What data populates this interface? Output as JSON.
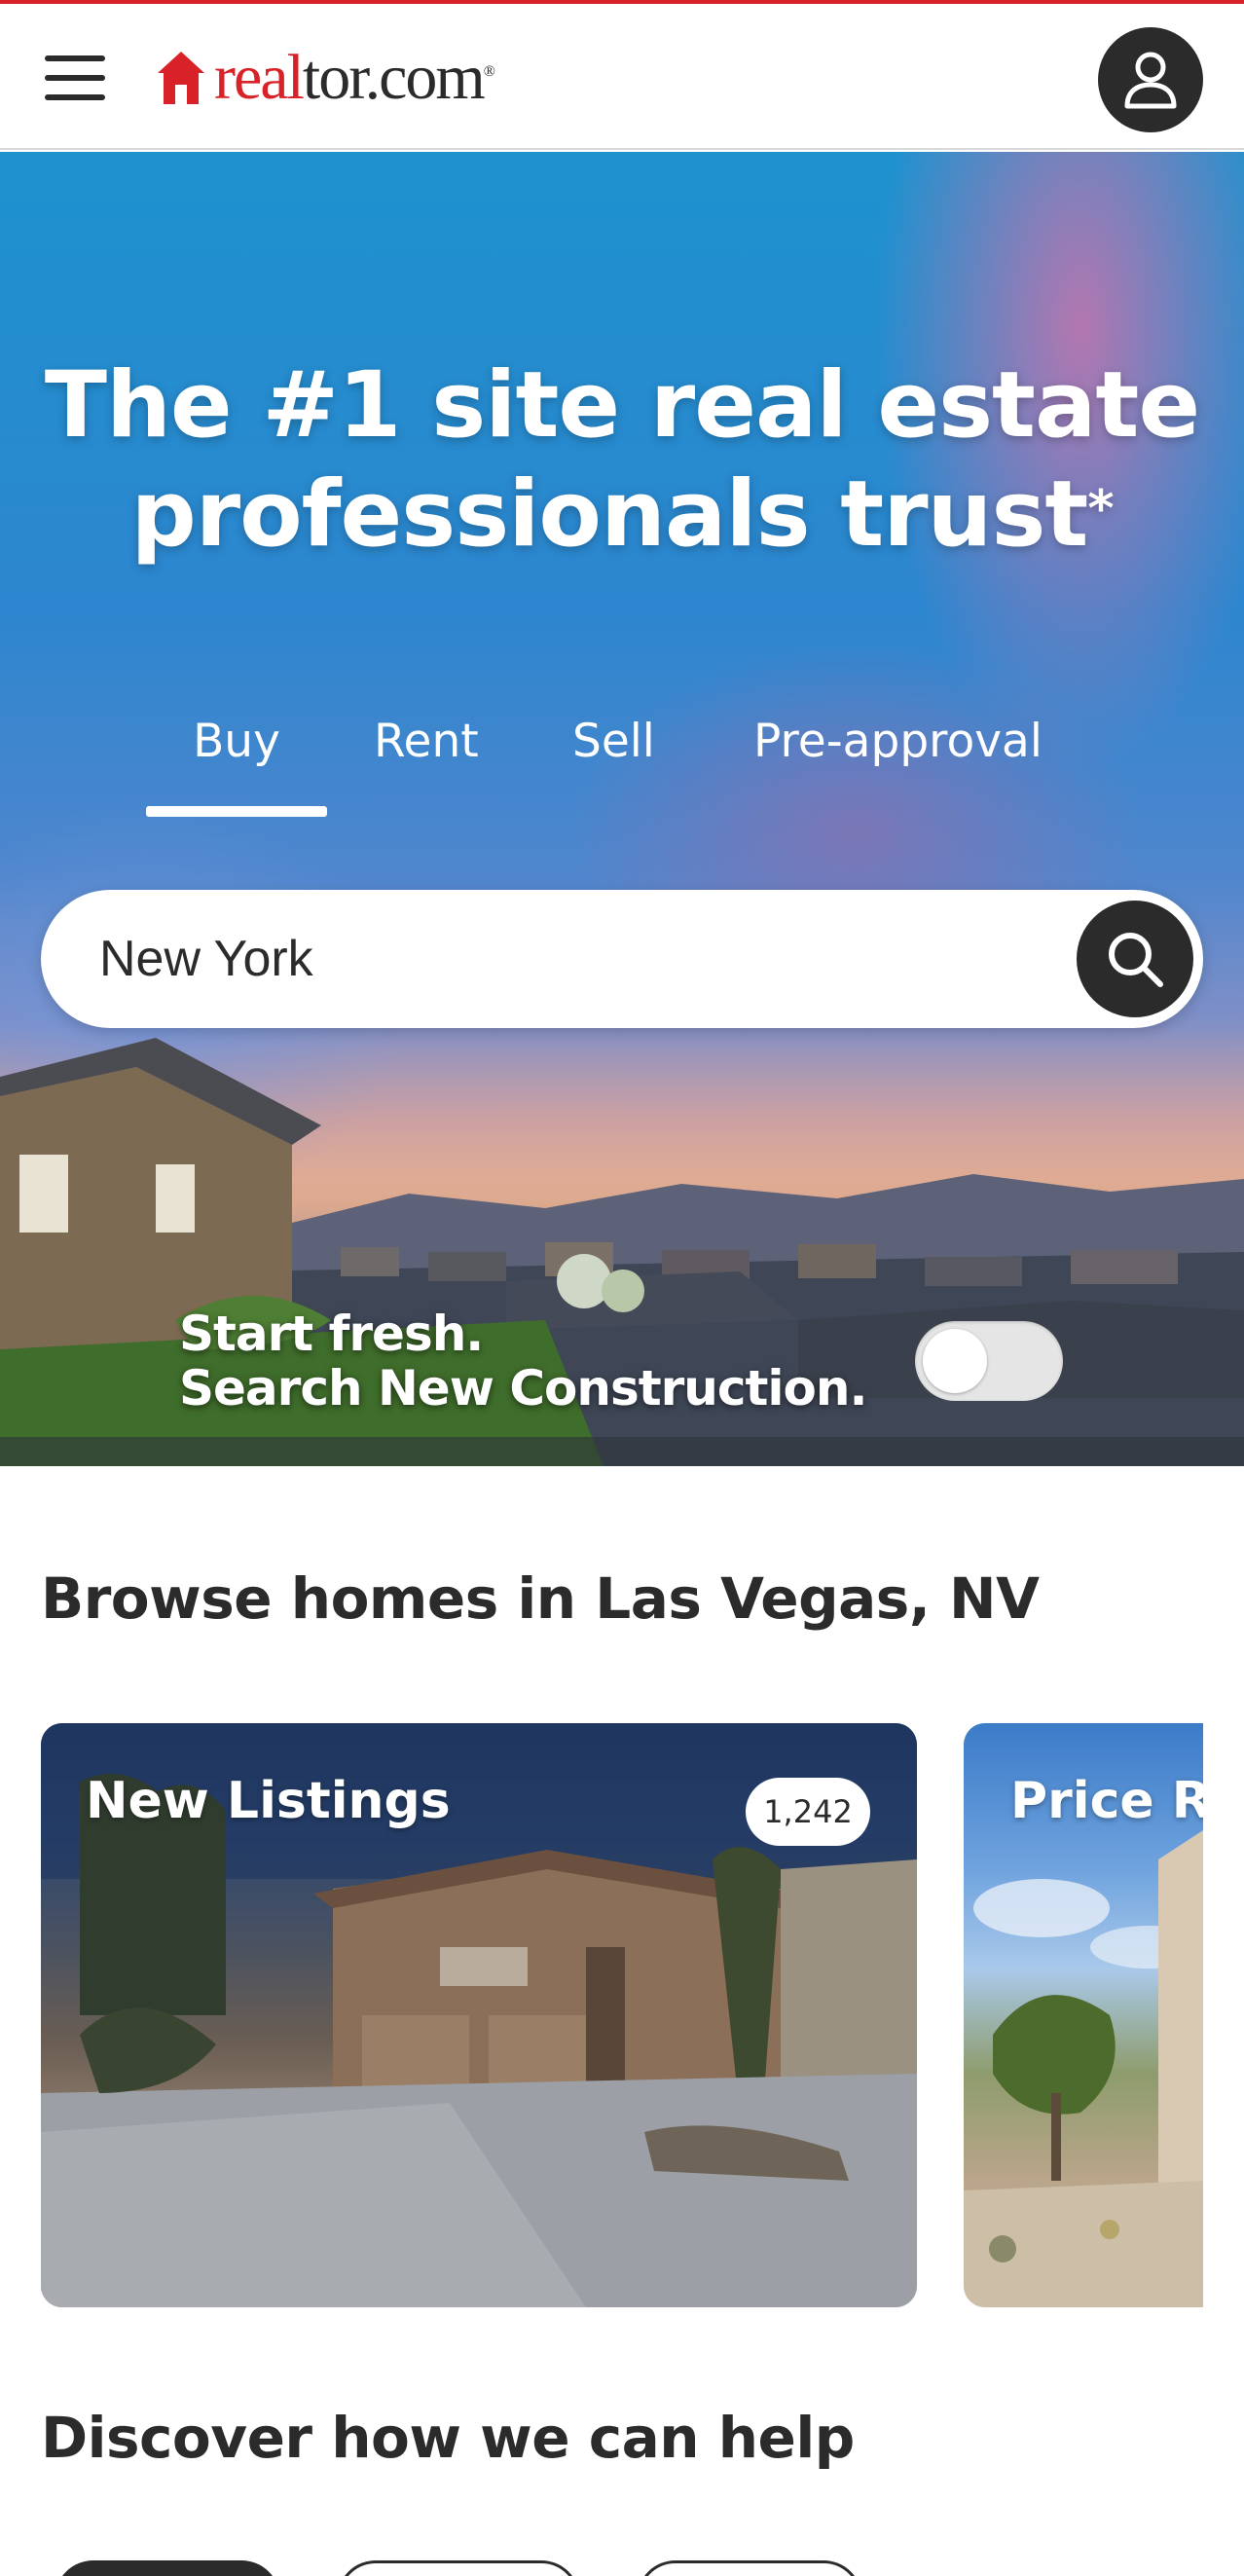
{
  "header": {
    "brand": "realtor.com",
    "brand_part_red": "real",
    "brand_part_dark": "tor.com",
    "brand_mark": "®",
    "menu_icon": "hamburger-menu-icon",
    "account_icon": "user-account-icon"
  },
  "hero": {
    "headline_line1": "The #1 site real estate",
    "headline_line2": "professionals trust",
    "headline_footnote": "*",
    "tabs": [
      {
        "label": "Buy",
        "selected": true
      },
      {
        "label": "Rent",
        "selected": false
      },
      {
        "label": "Sell",
        "selected": false
      },
      {
        "label": "Pre-approval",
        "selected": false
      }
    ],
    "search": {
      "value": "New York",
      "search_icon": "search-icon"
    },
    "promo_line1": "Start fresh.",
    "promo_line2": "Search New Construction.",
    "new_construction_toggle": false
  },
  "browse": {
    "title": "Browse homes in Las Vegas, NV",
    "cards": [
      {
        "title": "New Listings",
        "count": "1,242"
      },
      {
        "title": "Price R"
      }
    ]
  },
  "help": {
    "title": "Discover how we can help"
  },
  "colors": {
    "brand_red": "#d92228",
    "text_dark": "#2b2b2b",
    "white": "#ffffff"
  }
}
